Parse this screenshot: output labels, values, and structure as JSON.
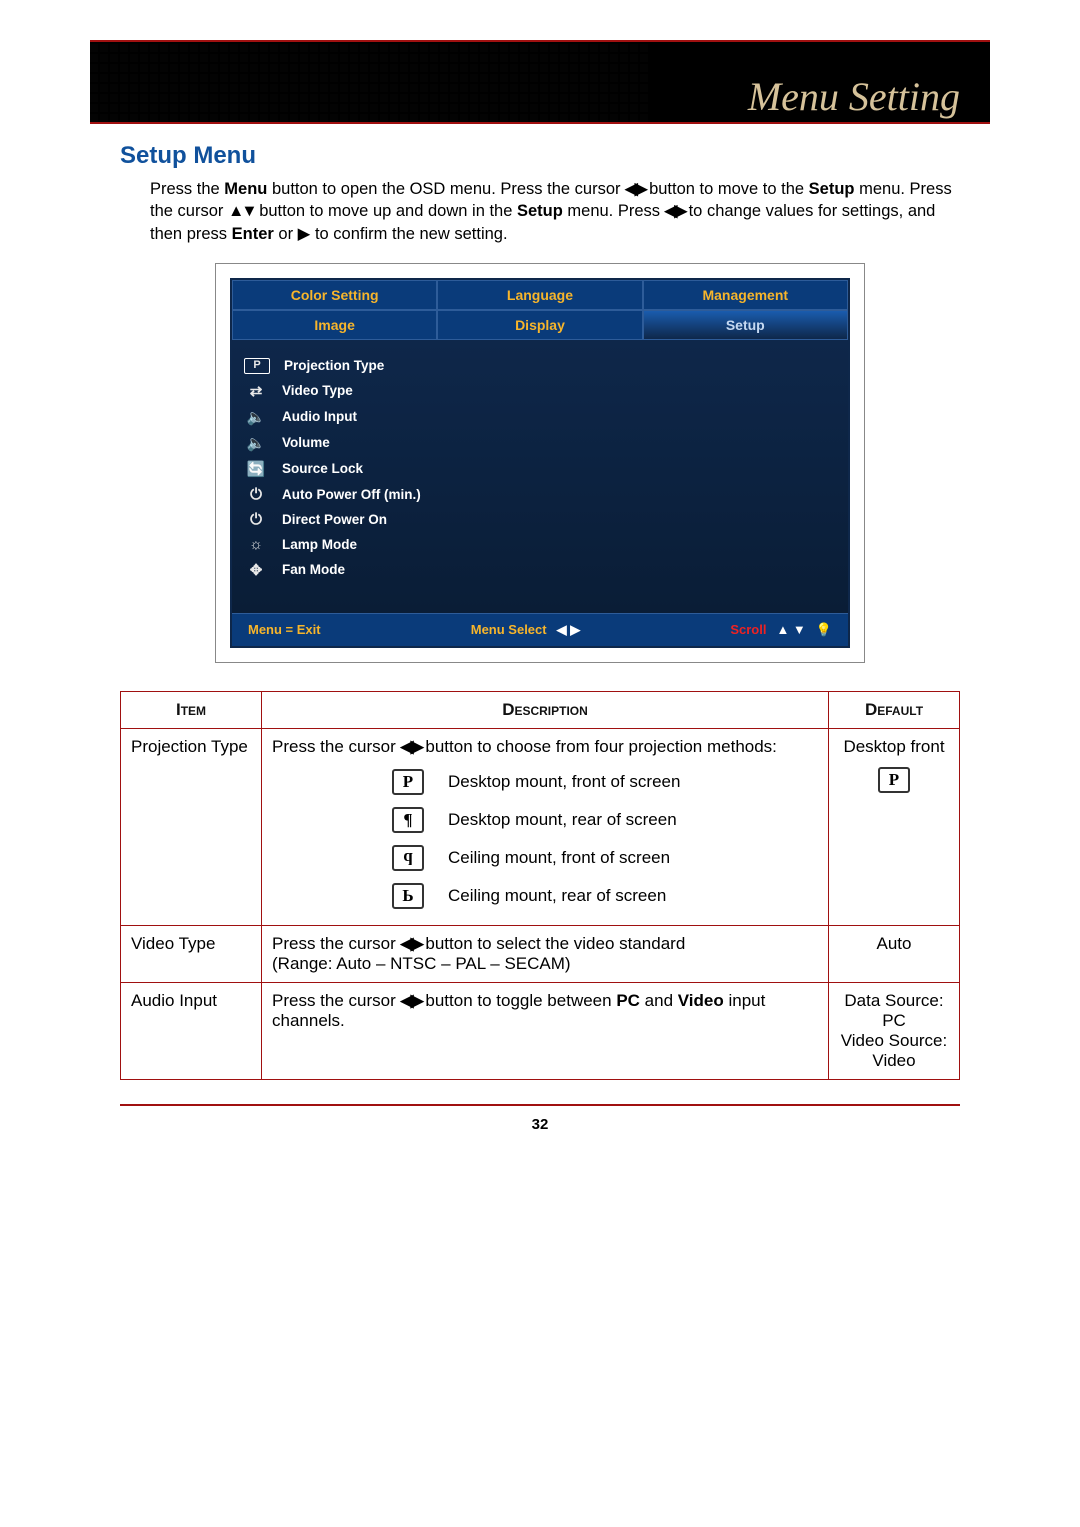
{
  "header": {
    "title": "Menu Setting"
  },
  "section": {
    "title": "Setup Menu"
  },
  "intro": {
    "p1a": "Press the ",
    "menu": "Menu",
    "p1b": " button to open the OSD menu. Press the cursor ",
    "lr": "◀▶",
    "p1c": " button to move to the ",
    "setup": "Setup",
    "p1d": " menu. Press the cursor ",
    "ud": "▲▼",
    "p1e": " button to move up and down in the ",
    "p1f": " menu. Press ",
    "p1g": " to change values for settings, and then press ",
    "enter": "Enter",
    "p1h": " or ",
    "play": "▶",
    "p1i": " to confirm the new setting."
  },
  "osd": {
    "tabs": {
      "t0": "Color Setting",
      "t1": "Language",
      "t2": "Management",
      "t3": "Image",
      "t4": "Display",
      "t5": "Setup"
    },
    "items": {
      "i0": "Projection Type",
      "i1": "Video Type",
      "i2": "Audio Input",
      "i3": "Volume",
      "i4": "Source Lock",
      "i5": "Auto Power Off (min.)",
      "i6": "Direct Power On",
      "i7": "Lamp Mode",
      "i8": "Fan Mode"
    },
    "footer": {
      "left": "Menu = Exit",
      "mid": "Menu Select",
      "midsym": "◀ ▶",
      "right": "Scroll",
      "rightsym": "▲ ▼"
    }
  },
  "table": {
    "headers": {
      "item": "Item",
      "desc": "Description",
      "def": "Default"
    },
    "rows": {
      "r0": {
        "item": "Projection Type",
        "lead": "Press the cursor ",
        "lr": "◀▶",
        "lead2": " button to choose from four projection methods:",
        "opt0": "Desktop mount, front of screen",
        "opt1": "Desktop mount, rear of screen",
        "opt2": "Ceiling mount, front of screen",
        "opt3": "Ceiling mount, rear of screen",
        "def": "Desktop front"
      },
      "r1": {
        "item": "Video Type",
        "d1": "Press the cursor ",
        "lr": "◀▶",
        "d2": " button to select the video standard",
        "d3": "(Range: Auto – NTSC – PAL – SECAM)",
        "def": "Auto"
      },
      "r2": {
        "item": "Audio Input",
        "d1": "Press the cursor ",
        "lr": "◀▶",
        "d2": " button to toggle between ",
        "pc": "PC",
        "d3": " and ",
        "vid": "Video",
        "d4": " input channels.",
        "def": "Data Source: PC\nVideo Source: Video"
      }
    }
  },
  "page_number": "32",
  "icons": {
    "p0": "P",
    "p1": "¶",
    "p2": "d",
    "p3": "Ь",
    "pdef": "P",
    "oi0": "P",
    "oi1": "⇄",
    "oi2": "🔈",
    "oi3": "🔈",
    "oi4": "🔄",
    "oi5": "⏻",
    "oi6": "⏻",
    "oi7": "☼",
    "oi8": "✥",
    "bulb": "💡"
  }
}
